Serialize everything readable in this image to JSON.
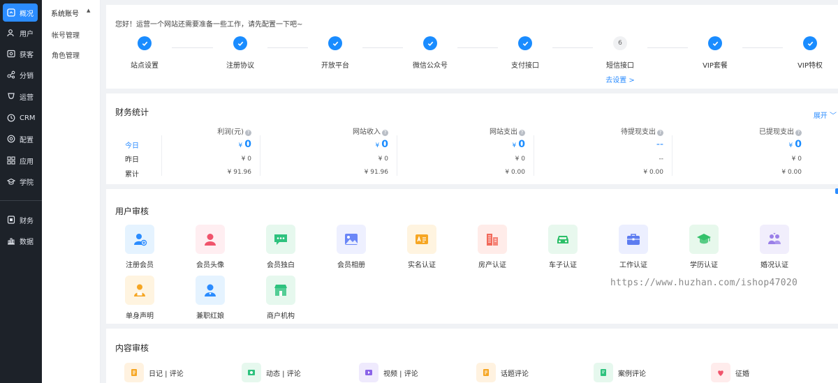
{
  "nav": {
    "items": [
      {
        "label": "概况",
        "icon": "dashboard-icon",
        "active": true
      },
      {
        "label": "用户",
        "icon": "users-icon"
      },
      {
        "label": "获客",
        "icon": "acquire-icon"
      },
      {
        "label": "分销",
        "icon": "share-icon"
      },
      {
        "label": "运营",
        "icon": "operation-icon"
      },
      {
        "label": "CRM",
        "icon": "clock-icon"
      },
      {
        "label": "配置",
        "icon": "settings-icon"
      },
      {
        "label": "应用",
        "icon": "apps-icon"
      },
      {
        "label": "学院",
        "icon": "academy-icon"
      },
      {
        "label": "财务",
        "icon": "finance-icon"
      },
      {
        "label": "数据",
        "icon": "data-chart-icon"
      }
    ]
  },
  "subnav": {
    "heading": "系统账号",
    "items": [
      "帐号管理",
      "角色管理"
    ]
  },
  "setup": {
    "greeting": "您好！运营一个网站还需要准备一些工作，请先配置一下吧~",
    "steps": [
      {
        "label": "站点设置",
        "done": true
      },
      {
        "label": "注册协议",
        "done": true
      },
      {
        "label": "开放平台",
        "done": true
      },
      {
        "label": "微信公众号",
        "done": true
      },
      {
        "label": "支付接口",
        "done": true
      },
      {
        "label": "短信接口",
        "done": false,
        "number": "6",
        "link": "去设置 >"
      },
      {
        "label": "VIP套餐",
        "done": true
      },
      {
        "label": "VIP特权",
        "done": true
      }
    ]
  },
  "finance": {
    "title": "财务统计",
    "expand": "展开",
    "rows": [
      "今日",
      "昨日",
      "累计"
    ],
    "currency": "¥",
    "columns": [
      {
        "header": "利润(元)",
        "today": "0",
        "yesterday": "¥ 0",
        "total": "¥ 91.96"
      },
      {
        "header": "网站收入",
        "today": "0",
        "yesterday": "¥ 0",
        "total": "¥ 91.96"
      },
      {
        "header": "网站支出",
        "today": "0",
        "yesterday": "¥ 0",
        "total": "¥ 0.00"
      },
      {
        "header": "待提现支出",
        "today": "--",
        "yesterday": "--",
        "total": "¥ 0.00"
      },
      {
        "header": "已提现支出",
        "today": "0",
        "yesterday": "¥ 0",
        "total": "¥ 0.00"
      }
    ]
  },
  "user_audit": {
    "title": "用户审核",
    "items": [
      {
        "label": "注册会员",
        "icon": "register-member-icon",
        "bg": "#e5f3ff",
        "fg": "#2b8cff"
      },
      {
        "label": "会员头像",
        "icon": "avatar-icon",
        "bg": "#ffeef1",
        "fg": "#f0546c"
      },
      {
        "label": "会员独白",
        "icon": "chat-bubble-icon",
        "bg": "#e6f8ee",
        "fg": "#2ec27e"
      },
      {
        "label": "会员相册",
        "icon": "photo-icon",
        "bg": "#eef0ff",
        "fg": "#6a86f7"
      },
      {
        "label": "实名认证",
        "icon": "id-card-icon",
        "bg": "#fff4e0",
        "fg": "#f6a623"
      },
      {
        "label": "房产认证",
        "icon": "building-icon",
        "bg": "#ffece9",
        "fg": "#f26a5b"
      },
      {
        "label": "车子认证",
        "icon": "car-icon",
        "bg": "#e8f8ee",
        "fg": "#2cbf68"
      },
      {
        "label": "工作认证",
        "icon": "briefcase-icon",
        "bg": "#ecefff",
        "fg": "#5d7cf0"
      },
      {
        "label": "学历认证",
        "icon": "graduation-icon",
        "bg": "#e7f8ec",
        "fg": "#34c16b"
      },
      {
        "label": "婚况认证",
        "icon": "couple-icon",
        "bg": "#f1eefc",
        "fg": "#9a7fe8"
      },
      {
        "label": "单身声明",
        "icon": "single-statement-icon",
        "bg": "#fff4e0",
        "fg": "#f6a623"
      },
      {
        "label": "兼职红娘",
        "icon": "matchmaker-icon",
        "bg": "#e5f3ff",
        "fg": "#2b8cff"
      },
      {
        "label": "商户机构",
        "icon": "shop-icon",
        "bg": "#e6f8ee",
        "fg": "#2ec27e"
      }
    ]
  },
  "content_audit": {
    "title": "内容审核",
    "items": [
      {
        "label": "日记 | 评论",
        "icon": "diary-icon",
        "bg": "#fff2e0",
        "fg": "#f6a623"
      },
      {
        "label": "动态 | 评论",
        "icon": "moment-icon",
        "bg": "#e6f8ee",
        "fg": "#2ec27e"
      },
      {
        "label": "视频 | 评论",
        "icon": "video-icon",
        "bg": "#efeafd",
        "fg": "#8a63e8"
      },
      {
        "label": "话题评论",
        "icon": "topic-icon",
        "bg": "#fff2e0",
        "fg": "#f6a623"
      },
      {
        "label": "案例评论",
        "icon": "case-icon",
        "bg": "#e6f8ee",
        "fg": "#2ec27e"
      },
      {
        "label": "征婚",
        "icon": "marriage-icon",
        "bg": "#ffecec",
        "fg": "#f0546c"
      }
    ]
  },
  "watermark": "https://www.huzhan.com/ishop47020"
}
